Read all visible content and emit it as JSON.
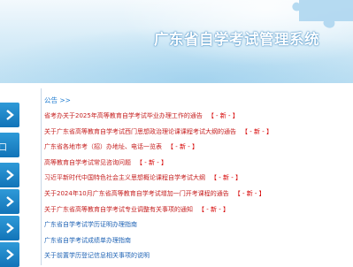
{
  "header": {
    "title": "广东省自学考试管理系统"
  },
  "left_nav": {
    "stub_glyph": "口"
  },
  "bulletin": {
    "label": "公告 >>"
  },
  "notices": [
    {
      "title": "省考办关于2025年高等教育自学考试毕业办理工作的通告",
      "new_badge": "【 - 新 - 】",
      "color": "red"
    },
    {
      "title": "关于广东省高等教育自学考试西门思想政治理论课课程考试大纲的通告",
      "new_badge": "【 - 新 - 】",
      "color": "red"
    },
    {
      "title": "广东省各地市考（招）办地址、电话一览表",
      "new_badge": "【 - 新 - 】",
      "color": "red"
    },
    {
      "title": "高等教育自学考试常见咨询问题",
      "new_badge": "【 - 新 - 】",
      "color": "red"
    },
    {
      "title": "习近平新时代中国特色社会主义思想概论课程自学考试大纲",
      "new_badge": "【 - 新 - 】",
      "color": "red"
    },
    {
      "title": "关于2024年10月广东省高等教育自学考试增加一门开考课程的通告",
      "new_badge": "【 - 新 - 】",
      "color": "red"
    },
    {
      "title": "关于广东省高等教育自学考试专业调整有关事项的通知",
      "new_badge": "【 - 新 - 】",
      "color": "red"
    },
    {
      "title": "广东省自学考试学历证明办理指南",
      "new_badge": "",
      "color": "blue"
    },
    {
      "title": "广东省自学考试成绩单办理指南",
      "new_badge": "",
      "color": "blue"
    },
    {
      "title": "关于前置学历登记信息相关事项的说明",
      "new_badge": "",
      "color": "blue"
    }
  ]
}
